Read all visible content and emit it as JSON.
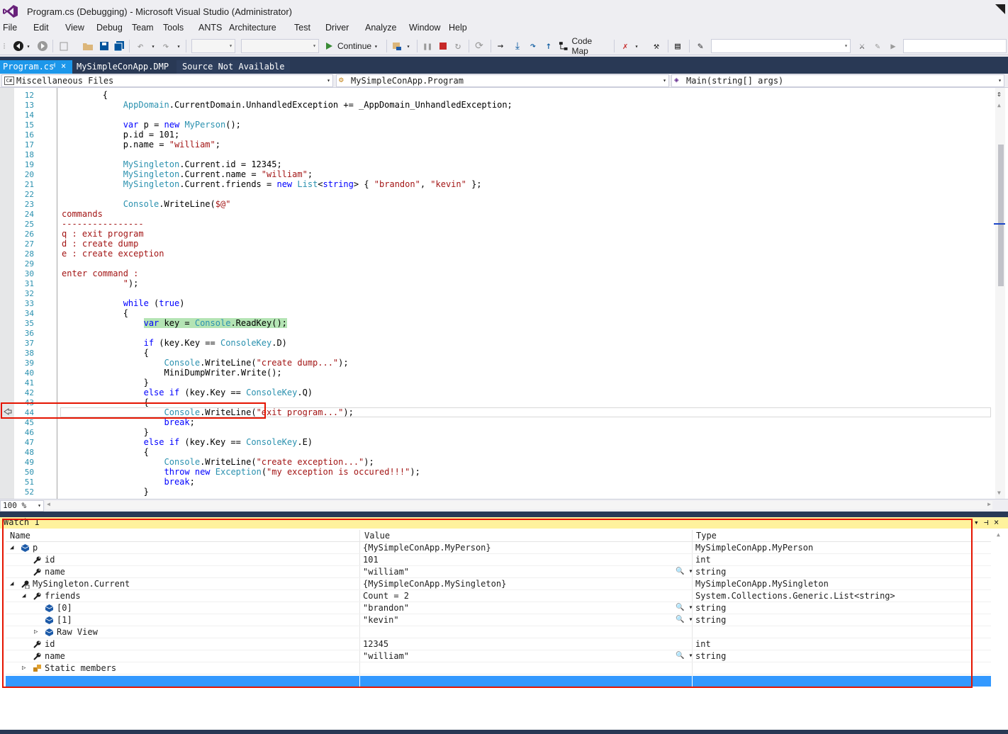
{
  "window": {
    "title": "Program.cs (Debugging) - Microsoft Visual Studio (Administrator)"
  },
  "menu": [
    "File",
    "Edit",
    "View",
    "Debug",
    "Team",
    "Tools",
    "ANTS",
    "Architecture",
    "Test",
    "Driver",
    "Analyze",
    "Window",
    "Help"
  ],
  "toolbar": {
    "continue_label": "Continue",
    "codemap_label": "Code Map"
  },
  "tabs": [
    {
      "label": "Program.cs",
      "pin": "⊣",
      "close": "×"
    },
    {
      "label": "MySimpleConApp.DMP"
    },
    {
      "label": "Source Not Available"
    }
  ],
  "navbar": {
    "project": "Miscellaneous Files",
    "type": "MySimpleConApp.Program",
    "member": "Main(string[] args)"
  },
  "editor": {
    "zoom": "100 %",
    "current_line": 35,
    "lines": [
      {
        "n": "12",
        "t": "        {"
      },
      {
        "n": "13",
        "t": "            AppDomain.CurrentDomain.UnhandledException += _AppDomain_UnhandledException;"
      },
      {
        "n": "14",
        "t": ""
      },
      {
        "n": "15",
        "t": "            var p = new MyPerson();"
      },
      {
        "n": "16",
        "t": "            p.id = 101;"
      },
      {
        "n": "17",
        "t": "            p.name = \"william\";"
      },
      {
        "n": "18",
        "t": ""
      },
      {
        "n": "19",
        "t": "            MySingleton.Current.id = 12345;"
      },
      {
        "n": "20",
        "t": "            MySingleton.Current.name = \"william\";"
      },
      {
        "n": "21",
        "t": "            MySingleton.Current.friends = new List<string> { \"brandon\", \"kevin\" };"
      },
      {
        "n": "22",
        "t": ""
      },
      {
        "n": "23",
        "t": "            Console.WriteLine($@\""
      },
      {
        "n": "24",
        "t": "commands"
      },
      {
        "n": "25",
        "t": "----------------"
      },
      {
        "n": "26",
        "t": "q : exit program"
      },
      {
        "n": "27",
        "t": "d : create dump"
      },
      {
        "n": "28",
        "t": "e : create exception"
      },
      {
        "n": "29",
        "t": ""
      },
      {
        "n": "30",
        "t": "enter command :"
      },
      {
        "n": "31",
        "t": "            \");"
      },
      {
        "n": "32",
        "t": ""
      },
      {
        "n": "33",
        "t": "            while (true)"
      },
      {
        "n": "34",
        "t": "            {"
      },
      {
        "n": "35",
        "t": "                var key = Console.ReadKey();"
      },
      {
        "n": "36",
        "t": ""
      },
      {
        "n": "37",
        "t": "                if (key.Key == ConsoleKey.D)"
      },
      {
        "n": "38",
        "t": "                {"
      },
      {
        "n": "39",
        "t": "                    Console.WriteLine(\"create dump...\");"
      },
      {
        "n": "40",
        "t": "                    MiniDumpWriter.Write();"
      },
      {
        "n": "41",
        "t": "                }"
      },
      {
        "n": "42",
        "t": "                else if (key.Key == ConsoleKey.Q)"
      },
      {
        "n": "43",
        "t": "                {"
      },
      {
        "n": "44",
        "t": "                    Console.WriteLine(\"exit program...\");"
      },
      {
        "n": "45",
        "t": "                    break;"
      },
      {
        "n": "46",
        "t": "                }"
      },
      {
        "n": "47",
        "t": "                else if (key.Key == ConsoleKey.E)"
      },
      {
        "n": "48",
        "t": "                {"
      },
      {
        "n": "49",
        "t": "                    Console.WriteLine(\"create exception...\");"
      },
      {
        "n": "50",
        "t": "                    throw new Exception(\"my exception is occured!!!\");"
      },
      {
        "n": "51",
        "t": "                    break;"
      },
      {
        "n": "52",
        "t": "                }"
      }
    ]
  },
  "watch": {
    "title": "Watch 1",
    "headers": {
      "name": "Name",
      "value": "Value",
      "type": "Type"
    },
    "rows": [
      {
        "name": "p",
        "value": "{MySimpleConApp.MyPerson}",
        "type": "MySimpleConApp.MyPerson",
        "level": 0,
        "exp": "◢",
        "icon": "object-icon"
      },
      {
        "name": "id",
        "value": "101",
        "type": "int",
        "level": 1,
        "exp": "",
        "icon": "property-icon"
      },
      {
        "name": "name",
        "value": "\"william\"",
        "type": "string",
        "level": 1,
        "exp": "",
        "icon": "property-icon",
        "mag": true
      },
      {
        "name": "MySingleton.Current",
        "value": "{MySimpleConApp.MySingleton}",
        "type": "MySimpleConApp.MySingleton",
        "level": 0,
        "exp": "◢",
        "icon": "static-property-icon"
      },
      {
        "name": "friends",
        "value": "Count = 2",
        "type": "System.Collections.Generic.List<string>",
        "level": 1,
        "exp": "◢",
        "icon": "property-icon"
      },
      {
        "name": "[0]",
        "value": "\"brandon\"",
        "type": "string",
        "level": 2,
        "exp": "",
        "icon": "object-icon",
        "mag": true
      },
      {
        "name": "[1]",
        "value": "\"kevin\"",
        "type": "string",
        "level": 2,
        "exp": "",
        "icon": "object-icon",
        "mag": true
      },
      {
        "name": "Raw View",
        "value": "",
        "type": "",
        "level": 2,
        "exp": "▷",
        "icon": "object-icon"
      },
      {
        "name": "id",
        "value": "12345",
        "type": "int",
        "level": 1,
        "exp": "",
        "icon": "property-icon"
      },
      {
        "name": "name",
        "value": "\"william\"",
        "type": "string",
        "level": 1,
        "exp": "",
        "icon": "property-icon",
        "mag": true
      },
      {
        "name": "Static members",
        "value": "",
        "type": "",
        "level": 1,
        "exp": "▷",
        "icon": "static-members-icon"
      }
    ],
    "mag_glyph": "🔍 ▾",
    "header_buttons": [
      "▾",
      "⊣",
      "×"
    ]
  }
}
